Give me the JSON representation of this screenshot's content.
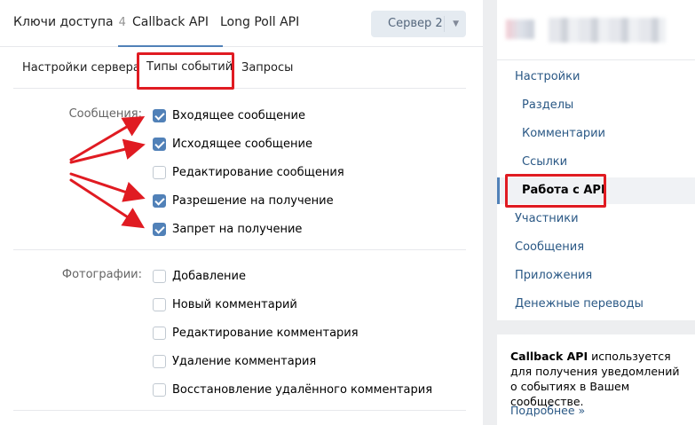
{
  "tabs": [
    {
      "label": "Ключи доступа",
      "count": "4"
    },
    {
      "label": "Callback API"
    },
    {
      "label": "Long Poll API"
    }
  ],
  "server_select": {
    "value": "Сервер 2"
  },
  "subtabs": [
    "Настройки сервера",
    "Типы событий",
    "Запросы"
  ],
  "sections": [
    {
      "label": "Сообщения:",
      "items": [
        {
          "label": "Входящее сообщение",
          "checked": true
        },
        {
          "label": "Исходящее сообщение",
          "checked": true
        },
        {
          "label": "Редактирование сообщения",
          "checked": false
        },
        {
          "label": "Разрешение на получение",
          "checked": true
        },
        {
          "label": "Запрет на получение",
          "checked": true
        }
      ]
    },
    {
      "label": "Фотографии:",
      "items": [
        {
          "label": "Добавление",
          "checked": false
        },
        {
          "label": "Новый комментарий",
          "checked": false
        },
        {
          "label": "Редактирование комментария",
          "checked": false
        },
        {
          "label": "Удаление комментария",
          "checked": false
        },
        {
          "label": "Восстановление удалённого комментария",
          "checked": false
        }
      ]
    }
  ],
  "side_menu": [
    {
      "label": "Настройки",
      "sub": false
    },
    {
      "label": "Разделы",
      "sub": true
    },
    {
      "label": "Комментарии",
      "sub": true
    },
    {
      "label": "Ссылки",
      "sub": true
    },
    {
      "label": "Работа с API",
      "sub": true,
      "active": true
    },
    {
      "label": "Участники",
      "sub": false
    },
    {
      "label": "Сообщения",
      "sub": false
    },
    {
      "label": "Приложения",
      "sub": false
    },
    {
      "label": "Денежные переводы",
      "sub": false
    }
  ],
  "info": {
    "bold": "Callback API",
    "text": " используется для получения уведомлений о событиях в Вашем сообществе.",
    "link": "Подробнее »"
  },
  "colors": {
    "accent": "#5181b8",
    "link": "#2a5885",
    "highlight_box": "#e01b22"
  }
}
